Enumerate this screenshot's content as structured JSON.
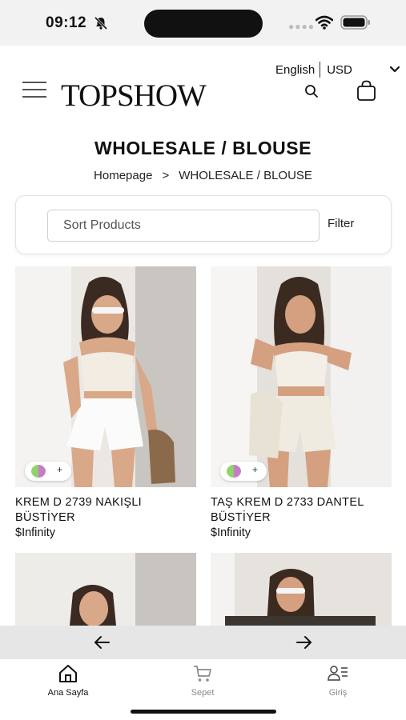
{
  "status_bar": {
    "time": "09:12"
  },
  "header": {
    "language": "English",
    "currency": "USD",
    "logo": "TOPSHOW"
  },
  "page": {
    "title": "WHOLESALE / BLOUSE",
    "breadcrumb_home": "Homepage",
    "breadcrumb_separator": ">",
    "breadcrumb_current": "WHOLESALE / BLOUSE"
  },
  "toolbar": {
    "sort_placeholder": "Sort Products",
    "filter_label": "Filter"
  },
  "products": [
    {
      "name": "KREM D 2739 NAKIŞLI BÜSTİYER",
      "price": "$Infinity"
    },
    {
      "name": "TAŞ KREM D 2733 DANTEL BÜSTİYER",
      "price": "$Infinity"
    }
  ],
  "tabs": [
    {
      "label": "Ana Sayfa",
      "icon": "home-icon",
      "active": true
    },
    {
      "label": "Sepet",
      "icon": "cart-icon",
      "active": false
    },
    {
      "label": "Giriş",
      "icon": "user-list-icon",
      "active": false
    }
  ],
  "colors": {
    "text": "#111111",
    "muted_tab": "#8a8a8a",
    "pager_bg": "#e6e6e6",
    "swatch_green": "#8fd46a",
    "swatch_purple": "#c77bc9"
  }
}
